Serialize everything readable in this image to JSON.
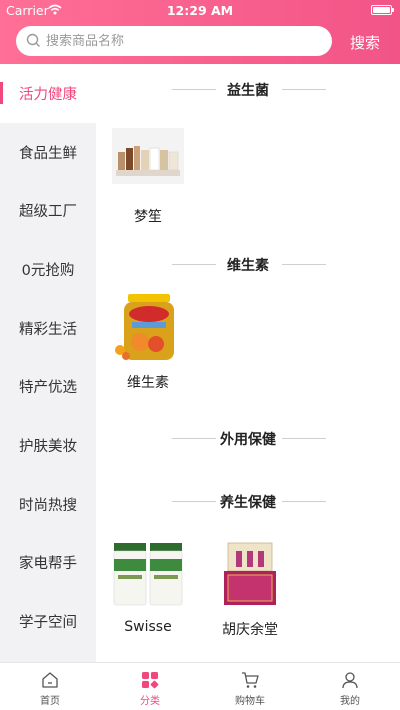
{
  "status_bar": {
    "carrier": "Carrier",
    "time": "12:29 AM"
  },
  "search": {
    "placeholder": "搜索商品名称",
    "button": "搜索"
  },
  "sidebar": {
    "items": [
      {
        "label": "活力健康",
        "active": true
      },
      {
        "label": "食品生鲜"
      },
      {
        "label": "超级工厂"
      },
      {
        "label": "0元抢购"
      },
      {
        "label": "精彩生活"
      },
      {
        "label": "特产优选"
      },
      {
        "label": "护肤美妆"
      },
      {
        "label": "时尚热搜"
      },
      {
        "label": "家电帮手"
      },
      {
        "label": "学子空间"
      }
    ]
  },
  "sections": [
    {
      "title": "益生菌",
      "products": [
        {
          "name": "梦笙"
        }
      ]
    },
    {
      "title": "维生素",
      "products": [
        {
          "name": "维生素"
        }
      ]
    },
    {
      "title": "外用保健",
      "products": []
    },
    {
      "title": "养生保健",
      "products": [
        {
          "name": "Swisse"
        },
        {
          "name": "胡庆余堂"
        }
      ]
    }
  ],
  "tabbar": {
    "items": [
      {
        "label": "首页",
        "icon": "home-icon"
      },
      {
        "label": "分类",
        "icon": "category-icon",
        "active": true
      },
      {
        "label": "购物车",
        "icon": "cart-icon"
      },
      {
        "label": "我的",
        "icon": "user-icon"
      }
    ]
  },
  "colors": {
    "brand": "#f0487d",
    "header_start": "#ff6f96",
    "header_end": "#f25487"
  }
}
